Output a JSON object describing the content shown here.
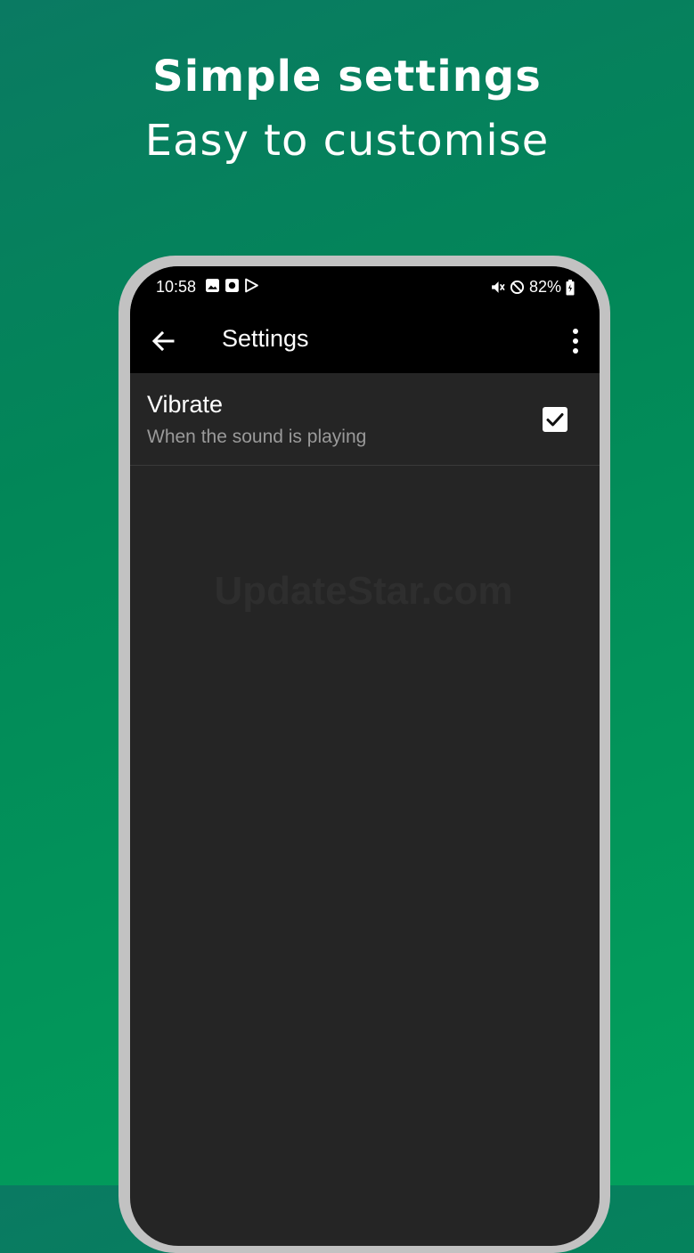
{
  "promo": {
    "headline": "Simple settings",
    "subline": "Easy to customise"
  },
  "status_bar": {
    "time": "10:58",
    "battery": "82%",
    "left_icons": [
      "gallery-icon",
      "app-notification-icon",
      "play-store-icon"
    ],
    "right_icons": [
      "mute-vibrate-icon",
      "do-not-disturb-icon",
      "battery-charging-icon"
    ]
  },
  "app_bar": {
    "title": "Settings",
    "back_icon": "arrow-back-icon",
    "menu_icon": "more-vert-icon"
  },
  "settings": [
    {
      "title": "Vibrate",
      "summary": "When the sound is playing",
      "checked": true
    }
  ],
  "watermark": "UpdateStar.com",
  "colors": {
    "background_top": "#0a7a62",
    "background_bottom": "#02a05c",
    "phone_frame": "#c2c2c2",
    "screen_bg": "#252525",
    "bar_bg": "#000000",
    "summary_text": "#9a9a9a"
  }
}
